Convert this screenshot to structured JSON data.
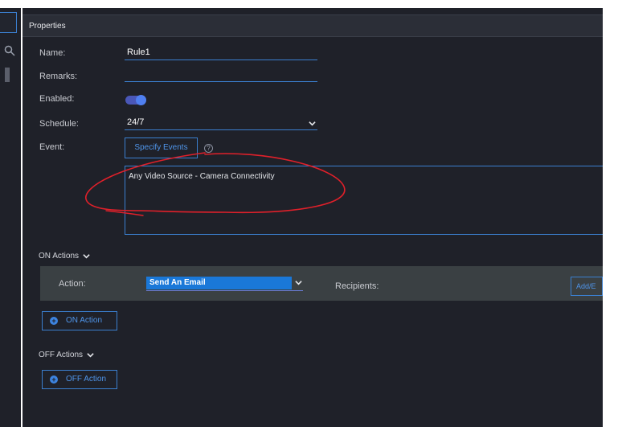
{
  "panel": {
    "title": "Properties"
  },
  "form": {
    "name_label": "Name:",
    "name_value": "Rule1",
    "remarks_label": "Remarks:",
    "remarks_value": "",
    "enabled_label": "Enabled:",
    "enabled_state": true,
    "schedule_label": "Schedule:",
    "schedule_value": "24/7",
    "event_label": "Event:",
    "specify_events_label": "Specify Events",
    "event_list": [
      "Any Video Source - Camera Connectivity"
    ]
  },
  "on_actions": {
    "header": "ON Actions",
    "action_label": "Action:",
    "action_value": "Send An Email",
    "recipients_label": "Recipients:",
    "add_button_label": "Add/E",
    "add_action_label": "ON Action"
  },
  "off_actions": {
    "header": "OFF Actions",
    "add_action_label": "OFF Action"
  },
  "colors": {
    "panel_bg": "#1f2129",
    "accent_blue": "#3b7fcf",
    "highlight_blue": "#1a78d8",
    "annotation_red": "#e0202a"
  },
  "icons": [
    "search-icon",
    "chevron-down-icon",
    "help-icon",
    "plus-circle-icon"
  ]
}
